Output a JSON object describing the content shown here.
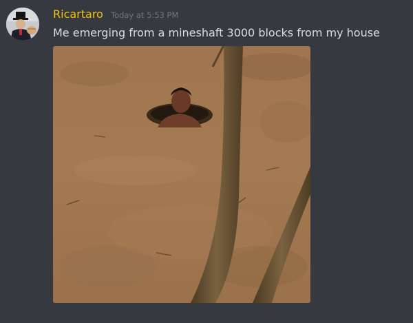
{
  "message": {
    "author": "Ricartaro",
    "timestamp": "Today at 5:53 PM",
    "content": "Me emerging from a mineshaft 3000 blocks from my house"
  },
  "colors": {
    "background": "#36393f",
    "username": "#f1c40f",
    "timestamp": "#72767d",
    "text": "#dcddde"
  },
  "icons": {
    "avatar": "user-avatar-icon"
  }
}
